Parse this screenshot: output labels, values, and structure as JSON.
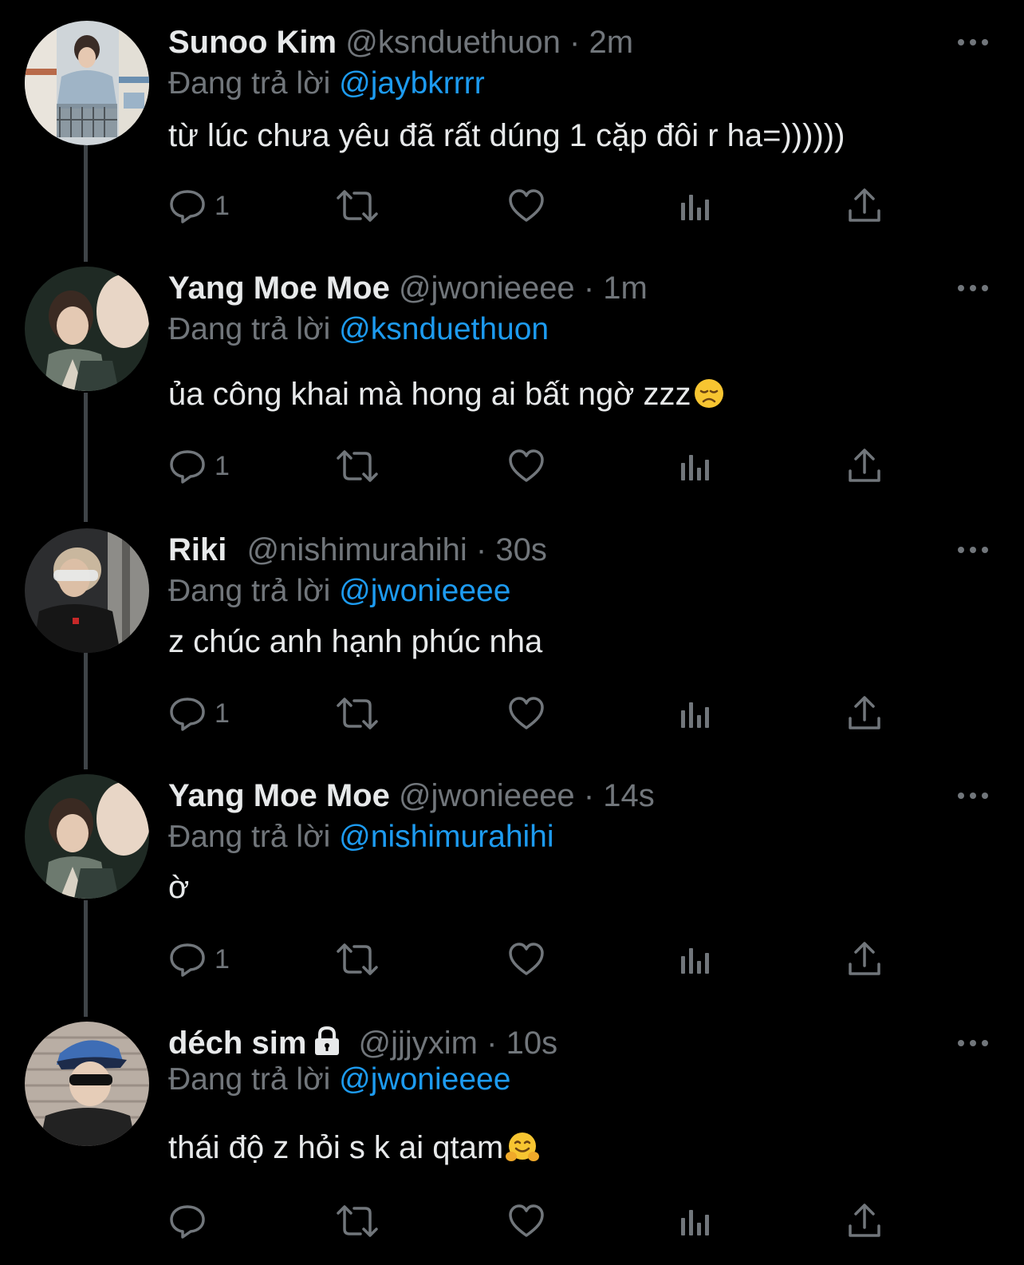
{
  "reply_prefix": "Đang trả lời",
  "tweets": [
    {
      "name": "Sunoo Kim",
      "handle": "@ksnduethuon",
      "dot": "·",
      "time": "2m",
      "reply_to": "@jaybkrrrr",
      "text": "từ lúc chưa yêu đã rất dúng 1 cặp đôi r ha=))))))",
      "reply_count": "1",
      "avatar_icon": "avatar-photo-shopping-cart"
    },
    {
      "name": "Yang Moe Moe",
      "handle": "@jwonieeee",
      "dot": "·",
      "time": "1m",
      "reply_to": "@ksnduethuon",
      "text": "ủa công khai mà hong ai bất ngờ zzz",
      "emoji": "disappointed-face",
      "reply_count": "1",
      "avatar_icon": "avatar-photo-fist"
    },
    {
      "name": "Riki",
      "handle": "@nishimurahihi",
      "dot": "·",
      "time": "30s",
      "reply_to": "@jwonieeee",
      "text": "z chúc anh hạnh phúc nha",
      "reply_count": "1",
      "avatar_icon": "avatar-photo-sunglasses"
    },
    {
      "name": "Yang Moe Moe",
      "handle": "@jwonieeee",
      "dot": "·",
      "time": "14s",
      "reply_to": "@nishimurahihi",
      "text": "ờ",
      "reply_count": "1",
      "avatar_icon": "avatar-photo-fist"
    },
    {
      "name": "déch sim",
      "handle": "@jjjyxim",
      "dot": "·",
      "time": "10s",
      "reply_to": "@jwonieeee",
      "text": "thái độ z hỏi s k ai qtam",
      "emoji": "hugging-face",
      "reply_count": "",
      "protected": true,
      "avatar_icon": "avatar-photo-cap"
    }
  ],
  "colors": {
    "background": "#000000",
    "text": "#e7e9ea",
    "secondary": "#71767b",
    "accent": "#1d9bf0",
    "thread_line": "#3f4448"
  }
}
